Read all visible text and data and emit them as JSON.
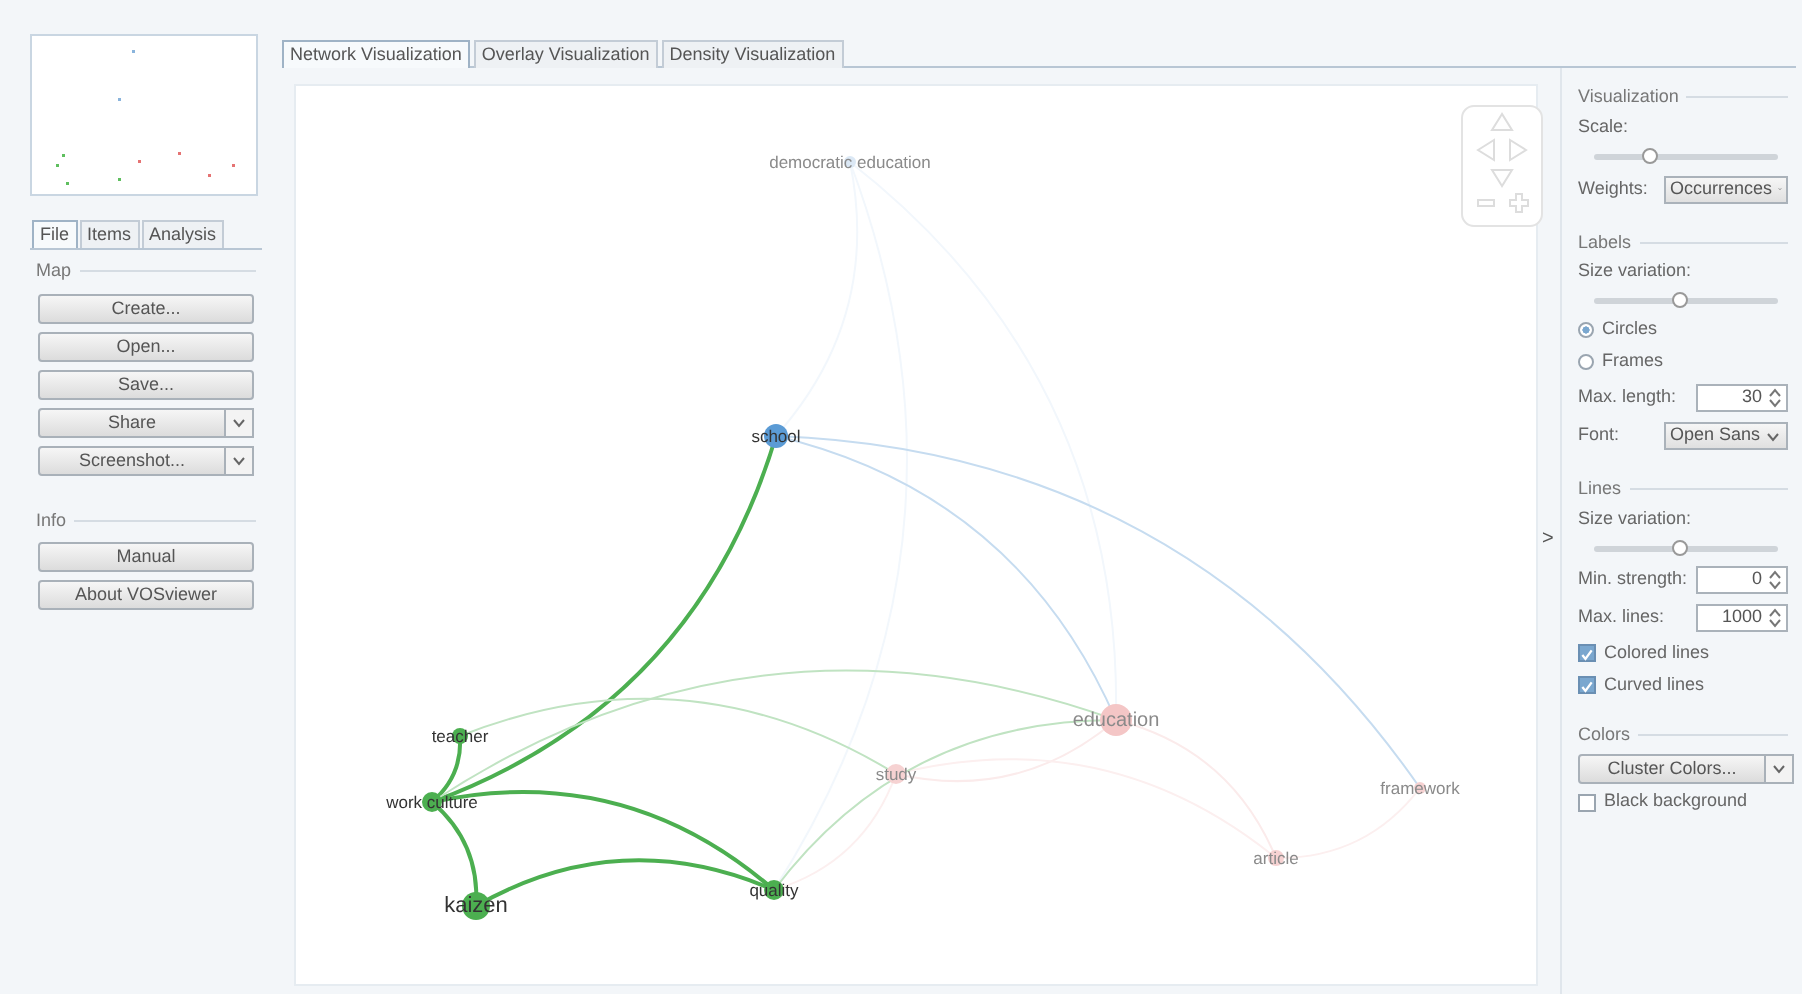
{
  "left_tabs": [
    {
      "label": "File",
      "selected": true
    },
    {
      "label": "Items",
      "selected": false
    },
    {
      "label": "Analysis",
      "selected": false
    }
  ],
  "left_sections": [
    {
      "title": "Map",
      "buttons": [
        {
          "label": "Create...",
          "kind": "button"
        },
        {
          "label": "Open...",
          "kind": "button"
        },
        {
          "label": "Save...",
          "kind": "button"
        },
        {
          "label": "Share",
          "kind": "split"
        },
        {
          "label": "Screenshot...",
          "kind": "split"
        }
      ]
    },
    {
      "title": "Info",
      "buttons": [
        {
          "label": "Manual",
          "kind": "button"
        },
        {
          "label": "About VOSviewer",
          "kind": "button"
        }
      ]
    }
  ],
  "main_tabs": [
    {
      "label": "Network Visualization",
      "selected": true
    },
    {
      "label": "Overlay Visualization",
      "selected": false
    },
    {
      "label": "Density Visualization",
      "selected": false
    }
  ],
  "map": {
    "nodes": [
      {
        "label": "democratic education",
        "color": "#dbe8f5",
        "highlighted": false
      },
      {
        "label": "school",
        "color": "#5b9bd5",
        "highlighted": true
      },
      {
        "label": "teacher",
        "color": "#4caf50",
        "highlighted": true
      },
      {
        "label": "work culture",
        "color": "#4caf50",
        "highlighted": true
      },
      {
        "label": "kaizen",
        "color": "#4caf50",
        "highlighted": true
      },
      {
        "label": "quality",
        "color": "#4caf50",
        "highlighted": true
      },
      {
        "label": "study",
        "color": "#f6d2d2",
        "highlighted": false
      },
      {
        "label": "education",
        "color": "#f4c6c6",
        "highlighted": false
      },
      {
        "label": "framework",
        "color": "#f6d2d2",
        "highlighted": false
      },
      {
        "label": "article",
        "color": "#f6d2d2",
        "highlighted": false
      }
    ]
  },
  "expander": ">",
  "settings": [
    {
      "title": "Visualization",
      "controls": [
        {
          "kind": "caption",
          "label": "Scale:"
        },
        {
          "kind": "slider",
          "level": 0.3
        },
        {
          "kind": "select",
          "label": "Weights:",
          "value": "Occurrences"
        }
      ]
    },
    {
      "title": "Labels",
      "controls": [
        {
          "kind": "caption",
          "label": "Size variation:"
        },
        {
          "kind": "slider",
          "level": 0.47
        },
        {
          "kind": "radio",
          "label": "Circles",
          "selected": true
        },
        {
          "kind": "radio",
          "label": "Frames",
          "selected": false
        },
        {
          "kind": "spin",
          "label": "Max. length:",
          "value": "30"
        },
        {
          "kind": "select",
          "label": "Font:",
          "value": "Open Sans"
        }
      ]
    },
    {
      "title": "Lines",
      "controls": [
        {
          "kind": "caption",
          "label": "Size variation:"
        },
        {
          "kind": "slider",
          "level": 0.47
        },
        {
          "kind": "spin",
          "label": "Min. strength:",
          "value": "0"
        },
        {
          "kind": "spin",
          "label": "Max. lines:",
          "value": "1000"
        },
        {
          "kind": "checkbox",
          "label": "Colored lines",
          "checked": true
        },
        {
          "kind": "checkbox",
          "label": "Curved lines",
          "checked": true
        }
      ]
    },
    {
      "title": "Colors",
      "controls": [
        {
          "kind": "split",
          "label": "Cluster Colors..."
        },
        {
          "kind": "checkbox",
          "label": "Black background",
          "checked": false
        }
      ]
    }
  ]
}
